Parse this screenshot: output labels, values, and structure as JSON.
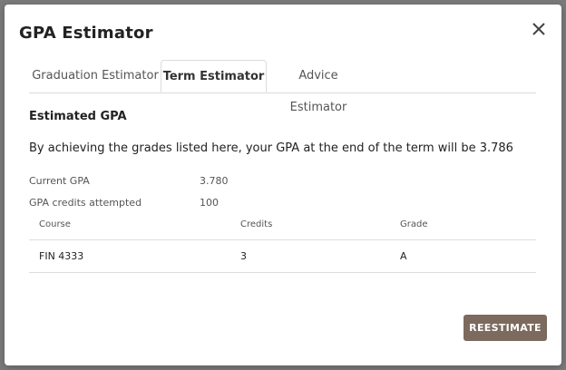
{
  "dialog": {
    "title": "GPA Estimator"
  },
  "tabs": [
    {
      "label": "Graduation Estimator",
      "active": false
    },
    {
      "label": "Term Estimator",
      "active": true
    },
    {
      "label": "Advice Estimator",
      "active": false
    }
  ],
  "content": {
    "section_title": "Estimated GPA",
    "summary": "By achieving the grades listed here, your GPA at the end of the term will be 3.786",
    "current_gpa": {
      "label": "Current GPA",
      "value": "3.780"
    },
    "credits_attempted": {
      "label": "GPA credits attempted",
      "value": "100"
    }
  },
  "table": {
    "headers": [
      "Course",
      "Credits",
      "Grade"
    ],
    "rows": [
      {
        "course": "FIN 4333",
        "credits": "3",
        "grade": "A"
      }
    ]
  },
  "actions": {
    "reestimate_label": "REESTIMATE"
  },
  "colors": {
    "button": "#7b6a5d",
    "overlay": "#7a7a7a"
  },
  "icons": {
    "close": "close-icon"
  }
}
